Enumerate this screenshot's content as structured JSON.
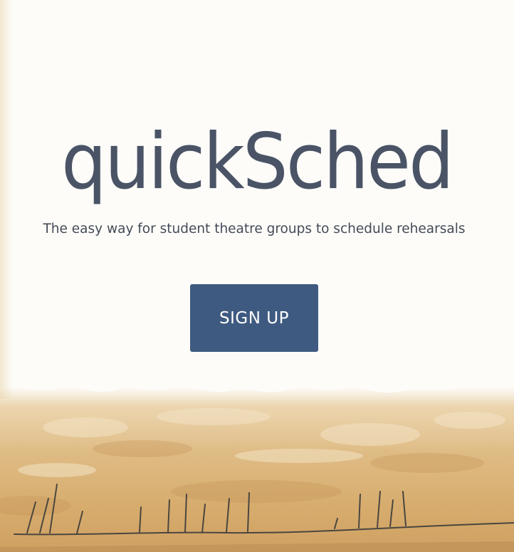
{
  "hero": {
    "brand_name": "quickSched",
    "tagline": "The easy way for student theatre groups to schedule rehearsals",
    "signup_label": "SIGN UP"
  },
  "colors": {
    "brand_text": "#4a5466",
    "tagline_text": "#444b57",
    "button_bg": "#3f5a80",
    "button_text": "#ffffff",
    "page_bg": "#fdfcf9",
    "watercolor_wash": "#d9b27a"
  },
  "background": {
    "icon": "watercolor-landscape-illustration"
  }
}
